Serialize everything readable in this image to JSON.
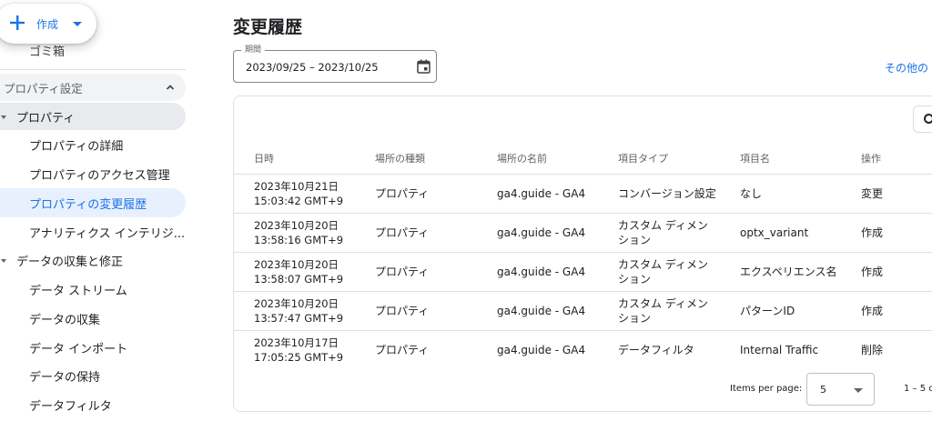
{
  "create_button": {
    "label": "作成"
  },
  "sidebar": {
    "trash": "ゴミ箱",
    "section": {
      "label": "プロパティ設定"
    },
    "groups": [
      {
        "label": "プロパティ"
      },
      {
        "label": "データの収集と修正"
      }
    ],
    "items": [
      {
        "label": "プロパティの詳細"
      },
      {
        "label": "プロパティのアクセス管理"
      },
      {
        "label": "プロパティの変更履歴"
      },
      {
        "label": "アナリティクス インテリジ..."
      },
      {
        "label": "データ ストリーム"
      },
      {
        "label": "データの収集"
      },
      {
        "label": "データ インポート"
      },
      {
        "label": "データの保持"
      },
      {
        "label": "データフィルタ"
      }
    ]
  },
  "main": {
    "title": "変更履歴",
    "date_field": {
      "legend": "期間",
      "value": "2023/09/25 – 2023/10/25"
    },
    "other_link": "その他の",
    "table": {
      "headers": [
        "日時",
        "場所の種類",
        "場所の名前",
        "項目タイプ",
        "項目名",
        "操作"
      ],
      "rows": [
        {
          "datetime": "2023年10月21日\n15:03:42 GMT+9",
          "location_type": "プロパティ",
          "location_name": "ga4.guide - GA4",
          "item_type": "コンバージョン設定",
          "item_name": "なし",
          "action": "変更"
        },
        {
          "datetime": "2023年10月20日\n13:58:16 GMT+9",
          "location_type": "プロパティ",
          "location_name": "ga4.guide - GA4",
          "item_type": "カスタム ディメンション",
          "item_name": "optx_variant",
          "action": "作成"
        },
        {
          "datetime": "2023年10月20日\n13:58:07 GMT+9",
          "location_type": "プロパティ",
          "location_name": "ga4.guide - GA4",
          "item_type": "カスタム ディメンション",
          "item_name": "エクスペリエンス名",
          "action": "作成"
        },
        {
          "datetime": "2023年10月20日\n13:57:47 GMT+9",
          "location_type": "プロパティ",
          "location_name": "ga4.guide - GA4",
          "item_type": "カスタム ディメンション",
          "item_name": "パターンID",
          "action": "作成"
        },
        {
          "datetime": "2023年10月17日\n17:05:25 GMT+9",
          "location_type": "プロパティ",
          "location_name": "ga4.guide - GA4",
          "item_type": "データフィルタ",
          "item_name": "Internal Traffic",
          "action": "削除"
        }
      ]
    },
    "pager": {
      "label": "Items per page:",
      "value": "5",
      "range": "1 – 5 c"
    }
  },
  "colors": {
    "accent": "#1a73e8",
    "selected_bg": "#e8f0fe",
    "divider": "#e0e0e0"
  }
}
